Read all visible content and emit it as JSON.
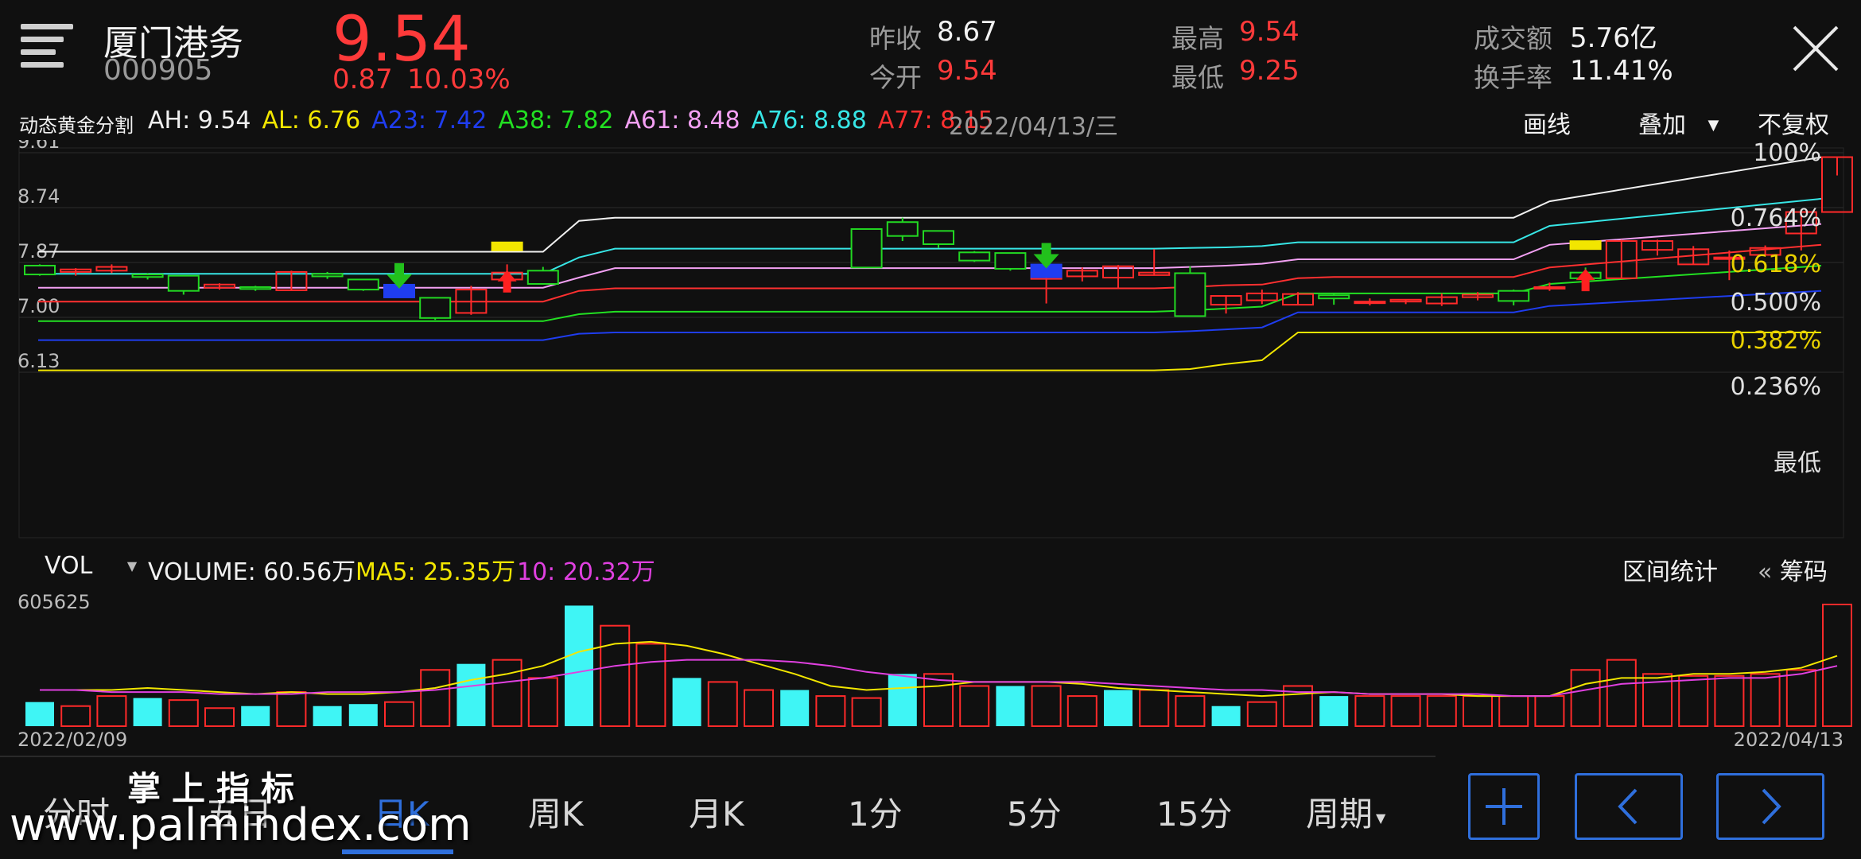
{
  "header": {
    "stock_name": "厦门港务",
    "stock_code": "000905",
    "price": "9.54",
    "change": "0.87",
    "change_pct": "10.03%",
    "prev_close_label": "昨收",
    "prev_close": "8.67",
    "open_label": "今开",
    "open": "9.54",
    "high_label": "最高",
    "high": "9.54",
    "low_label": "最低",
    "low": "9.25",
    "turnover_amount_label": "成交额",
    "turnover_amount": "5.76亿",
    "turnover_rate_label": "换手率",
    "turnover_rate": "11.41%"
  },
  "indicator": {
    "name": "动态黄金分割",
    "items": [
      {
        "text": "AH: 9.54",
        "color": "#f0f0f0"
      },
      {
        "text": "AL: 6.76",
        "color": "#f2e600"
      },
      {
        "text": "A23: 7.42",
        "color": "#1f3df0"
      },
      {
        "text": "A38: 7.82",
        "color": "#22e022"
      },
      {
        "text": "A61: 8.48",
        "color": "#f3a0f3"
      },
      {
        "text": "A76: 8.88",
        "color": "#37e6e6"
      },
      {
        "text": "A77: 8.15",
        "color": "#ff3030"
      }
    ],
    "date": "2022/04/13/三",
    "draw_line": "画线",
    "overlay": "叠加",
    "no_adjust": "不复权"
  },
  "main_chart": {
    "y_ticks": [
      "9.61",
      "8.74",
      "7.87",
      "7.00",
      "6.13"
    ],
    "fib_labels": [
      {
        "text": "100%",
        "color": "#e0e0e0"
      },
      {
        "text": "0.764%",
        "color": "#e0e0e0"
      },
      {
        "text": "0.618%",
        "color": "#e8d000"
      },
      {
        "text": "0.500%",
        "color": "#e0e0e0"
      },
      {
        "text": "0.382%",
        "color": "#e8d000"
      },
      {
        "text": "0.236%",
        "color": "#e0e0e0"
      },
      {
        "text": "最低",
        "color": "#e0e0e0"
      }
    ]
  },
  "volume": {
    "selector": "VOL",
    "volume_text": "VOLUME: 60.56万",
    "ma5_text": "MA5: 25.35万",
    "ma10_text": "10: 20.32万",
    "range_stats": "区间统计",
    "chips": "筹码",
    "max_label": "605625",
    "start_date": "2022/02/09",
    "end_date": "2022/04/13"
  },
  "tabs": [
    "分时",
    "五日",
    "日K",
    "周K",
    "月K",
    "1分",
    "5分",
    "15分",
    "周期"
  ],
  "active_tab": "日K",
  "watermark": {
    "top": "掌上指标",
    "bottom": "www.palmindex.com"
  },
  "chart_data": {
    "type": "candlestick",
    "start_date": "2022/02/09",
    "end_date": "2022/04/13",
    "y_range": [
      6.13,
      9.61
    ],
    "candles": [
      [
        7.82,
        7.68,
        7.84,
        7.66
      ],
      [
        7.72,
        7.76,
        7.78,
        7.66
      ],
      [
        7.74,
        7.8,
        7.84,
        7.7
      ],
      [
        7.68,
        7.64,
        7.7,
        7.6
      ],
      [
        7.66,
        7.42,
        7.66,
        7.36
      ],
      [
        7.47,
        7.52,
        7.54,
        7.44
      ],
      [
        7.48,
        7.45,
        7.5,
        7.42
      ],
      [
        7.43,
        7.72,
        7.74,
        7.42
      ],
      [
        7.69,
        7.65,
        7.72,
        7.61
      ],
      [
        7.6,
        7.44,
        7.6,
        7.42
      ],
      [
        7.4,
        7.44,
        7.48,
        7.38
      ],
      [
        7.31,
        6.99,
        7.31,
        6.96
      ],
      [
        7.07,
        7.44,
        7.5,
        7.04
      ],
      [
        7.6,
        7.71,
        7.84,
        7.52
      ],
      [
        7.74,
        7.53,
        7.8,
        7.52
      ],
      [
        8.4,
        7.79,
        8.4,
        7.79
      ],
      [
        8.51,
        8.29,
        8.58,
        8.21
      ],
      [
        8.37,
        8.16,
        8.38,
        8.1
      ],
      [
        8.03,
        7.9,
        8.05,
        7.88
      ],
      [
        8.02,
        7.77,
        8.02,
        7.74
      ],
      [
        7.61,
        7.77,
        7.8,
        7.22
      ],
      [
        7.65,
        7.74,
        7.79,
        7.57
      ],
      [
        7.63,
        7.81,
        7.83,
        7.45
      ],
      [
        7.67,
        7.71,
        8.08,
        7.66
      ],
      [
        7.7,
        7.02,
        7.81,
        7.02
      ],
      [
        7.2,
        7.34,
        7.34,
        7.06
      ],
      [
        7.27,
        7.38,
        7.44,
        7.21
      ],
      [
        7.2,
        7.37,
        7.4,
        7.19
      ],
      [
        7.35,
        7.3,
        7.38,
        7.2
      ],
      [
        7.24,
        7.25,
        7.3,
        7.19
      ],
      [
        7.25,
        7.28,
        7.29,
        7.21
      ],
      [
        7.22,
        7.32,
        7.38,
        7.18
      ],
      [
        7.32,
        7.36,
        7.4,
        7.27
      ],
      [
        7.42,
        7.26,
        7.44,
        7.19
      ],
      [
        7.47,
        7.48,
        7.55,
        7.42
      ],
      [
        7.71,
        7.62,
        7.79,
        7.54
      ],
      [
        7.62,
        8.21,
        8.23,
        7.62
      ],
      [
        8.07,
        8.21,
        8.23,
        7.98
      ],
      [
        7.84,
        8.08,
        8.13,
        7.84
      ],
      [
        7.94,
        7.95,
        8.06,
        7.59
      ],
      [
        7.99,
        8.1,
        8.14,
        7.98
      ],
      [
        8.33,
        8.67,
        8.71,
        8.06
      ],
      [
        8.67,
        9.54,
        9.54,
        9.25
      ]
    ],
    "golden_lines": {
      "AH": [
        8.04,
        8.04,
        8.04,
        8.04,
        8.04,
        8.04,
        8.04,
        8.04,
        8.04,
        8.04,
        8.04,
        8.04,
        8.04,
        8.04,
        8.04,
        8.53,
        8.58,
        8.58,
        8.58,
        8.58,
        8.58,
        8.58,
        8.58,
        8.58,
        8.58,
        8.58,
        8.58,
        8.58,
        8.58,
        8.58,
        8.58,
        8.58,
        8.58,
        8.58,
        8.58,
        8.58,
        8.58,
        8.58,
        8.58,
        8.58,
        8.58,
        8.58,
        8.84,
        9.54
      ],
      "A76": [
        7.69,
        7.69,
        7.69,
        7.69,
        7.69,
        7.69,
        7.69,
        7.69,
        7.69,
        7.69,
        7.69,
        7.69,
        7.69,
        7.69,
        7.69,
        7.95,
        8.09,
        8.09,
        8.09,
        8.09,
        8.09,
        8.09,
        8.09,
        8.09,
        8.09,
        8.09,
        8.09,
        8.09,
        8.09,
        8.09,
        8.09,
        8.09,
        8.1,
        8.11,
        8.13,
        8.19,
        8.19,
        8.19,
        8.19,
        8.19,
        8.19,
        8.19,
        8.45,
        8.88
      ],
      "A61": [
        7.47,
        7.47,
        7.47,
        7.47,
        7.47,
        7.47,
        7.47,
        7.47,
        7.47,
        7.47,
        7.47,
        7.47,
        7.47,
        7.47,
        7.47,
        7.63,
        7.78,
        7.78,
        7.78,
        7.78,
        7.78,
        7.78,
        7.78,
        7.78,
        7.78,
        7.78,
        7.78,
        7.78,
        7.78,
        7.78,
        7.78,
        7.78,
        7.8,
        7.82,
        7.85,
        7.92,
        7.92,
        7.92,
        7.92,
        7.92,
        7.92,
        7.92,
        8.15,
        8.48
      ],
      "A77": [
        7.25,
        7.25,
        7.25,
        7.25,
        7.25,
        7.25,
        7.25,
        7.25,
        7.25,
        7.25,
        7.25,
        7.25,
        7.25,
        7.25,
        7.25,
        7.42,
        7.46,
        7.46,
        7.46,
        7.46,
        7.46,
        7.46,
        7.46,
        7.46,
        7.46,
        7.46,
        7.46,
        7.46,
        7.46,
        7.46,
        7.46,
        7.46,
        7.48,
        7.51,
        7.52,
        7.62,
        7.64,
        7.64,
        7.64,
        7.64,
        7.64,
        7.64,
        7.79,
        8.15
      ],
      "A38": [
        6.94,
        6.94,
        6.94,
        6.94,
        6.94,
        6.94,
        6.94,
        6.94,
        6.94,
        6.94,
        6.94,
        6.94,
        6.94,
        6.94,
        6.94,
        7.05,
        7.09,
        7.09,
        7.09,
        7.09,
        7.09,
        7.09,
        7.09,
        7.09,
        7.09,
        7.09,
        7.09,
        7.09,
        7.09,
        7.09,
        7.09,
        7.09,
        7.11,
        7.14,
        7.17,
        7.38,
        7.38,
        7.38,
        7.38,
        7.38,
        7.38,
        7.38,
        7.53,
        7.82
      ],
      "A23": [
        6.64,
        6.64,
        6.64,
        6.64,
        6.64,
        6.64,
        6.64,
        6.64,
        6.64,
        6.64,
        6.64,
        6.64,
        6.64,
        6.64,
        6.64,
        6.74,
        6.76,
        6.76,
        6.76,
        6.76,
        6.76,
        6.76,
        6.76,
        6.76,
        6.76,
        6.76,
        6.76,
        6.76,
        6.76,
        6.76,
        6.76,
        6.76,
        6.78,
        6.81,
        6.84,
        7.08,
        7.08,
        7.08,
        7.08,
        7.08,
        7.08,
        7.08,
        7.18,
        7.42
      ],
      "AL": [
        6.16,
        6.16,
        6.16,
        6.16,
        6.16,
        6.16,
        6.16,
        6.16,
        6.16,
        6.16,
        6.16,
        6.16,
        6.16,
        6.16,
        6.16,
        6.16,
        6.16,
        6.16,
        6.16,
        6.16,
        6.16,
        6.16,
        6.16,
        6.16,
        6.16,
        6.16,
        6.16,
        6.16,
        6.16,
        6.16,
        6.16,
        6.16,
        6.18,
        6.26,
        6.32,
        6.76,
        6.76,
        6.76,
        6.76,
        6.76,
        6.76,
        6.76,
        6.76,
        6.76
      ]
    },
    "signals": [
      {
        "index": 10,
        "type": "buy-arrow",
        "color": "#22c01c"
      },
      {
        "index": 13,
        "type": "sell-arrow",
        "color": "#ff2020"
      },
      {
        "index": 20,
        "type": "buy-arrow",
        "color": "#22c01c"
      },
      {
        "index": 35,
        "type": "sell-arrow",
        "color": "#ff2020"
      }
    ],
    "volume": [
      12,
      10,
      15,
      14,
      13,
      9,
      10,
      17,
      10,
      11,
      12,
      28,
      31,
      33,
      24,
      60,
      50,
      41,
      24,
      22,
      18,
      18,
      15,
      14,
      26,
      26,
      20,
      20,
      20,
      15,
      18,
      18,
      15,
      10,
      12,
      20,
      15,
      15,
      15,
      15,
      15,
      15,
      15,
      28,
      33,
      26,
      25,
      25,
      26,
      28,
      60.56
    ],
    "volume_range": [
      0,
      60.56
    ],
    "ma5": [
      18,
      18,
      18,
      19,
      18,
      17,
      16,
      17,
      16,
      16,
      17,
      19,
      23,
      26,
      30,
      37,
      41,
      42,
      40,
      36,
      31,
      26,
      20,
      18,
      19,
      20,
      22,
      22,
      22,
      21,
      19,
      18,
      17,
      16,
      15,
      16,
      17,
      16,
      16,
      16,
      15,
      15,
      15,
      21,
      24,
      24,
      26,
      26,
      27,
      29,
      35
    ],
    "ma10": [
      18,
      18,
      17,
      17,
      17,
      16,
      16,
      16,
      17,
      17,
      17,
      18,
      20,
      22,
      24,
      27,
      30,
      32,
      33,
      33,
      33,
      32,
      30,
      27,
      25,
      23,
      22,
      22,
      22,
      22,
      21,
      20,
      19,
      18,
      18,
      17,
      17,
      16,
      16,
      16,
      16,
      15,
      15,
      18,
      21,
      22,
      23,
      24,
      24,
      26,
      30
    ]
  }
}
